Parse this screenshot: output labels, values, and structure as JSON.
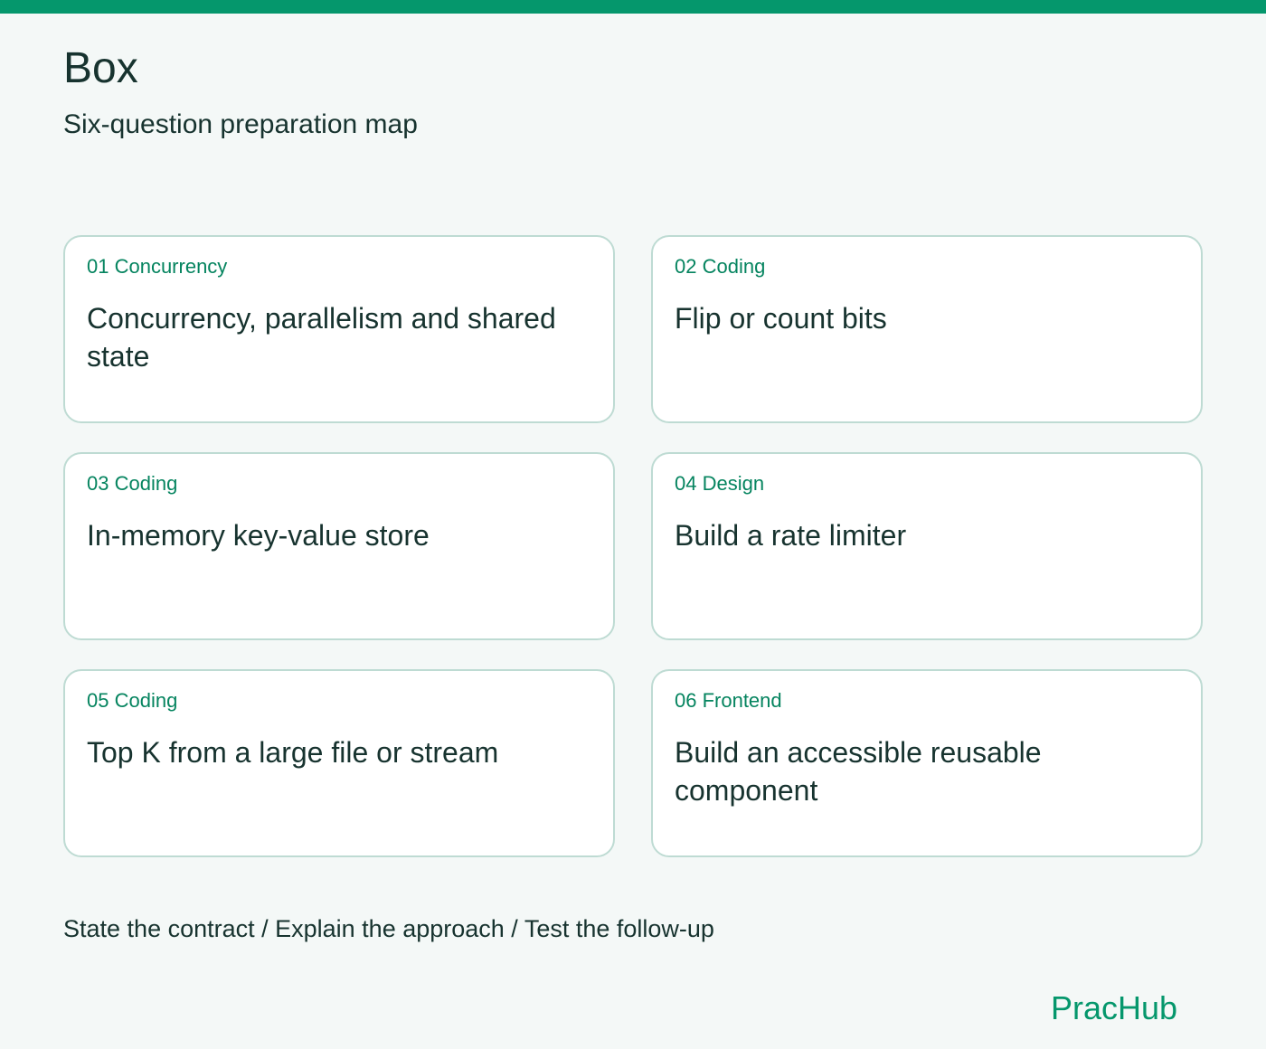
{
  "header": {
    "title": "Box",
    "subtitle": "Six-question preparation map"
  },
  "cards": [
    {
      "tag": "01 Concurrency",
      "title": "Concurrency, parallelism and shared state"
    },
    {
      "tag": "02 Coding",
      "title": "Flip or count bits"
    },
    {
      "tag": "03 Coding",
      "title": "In-memory key-value store"
    },
    {
      "tag": "04 Design",
      "title": "Build a rate limiter"
    },
    {
      "tag": "05 Coding",
      "title": "Top K from a large file or stream"
    },
    {
      "tag": "06 Frontend",
      "title": "Build an accessible reusable component"
    }
  ],
  "footer": {
    "note": "State the contract / Explain the approach / Test the follow-up",
    "brand": "PracHub"
  },
  "colors": {
    "accent": "#05976c",
    "tag": "#05845f",
    "text": "#17332f",
    "card_border": "#bedbd3",
    "background": "#f4f8f7"
  }
}
